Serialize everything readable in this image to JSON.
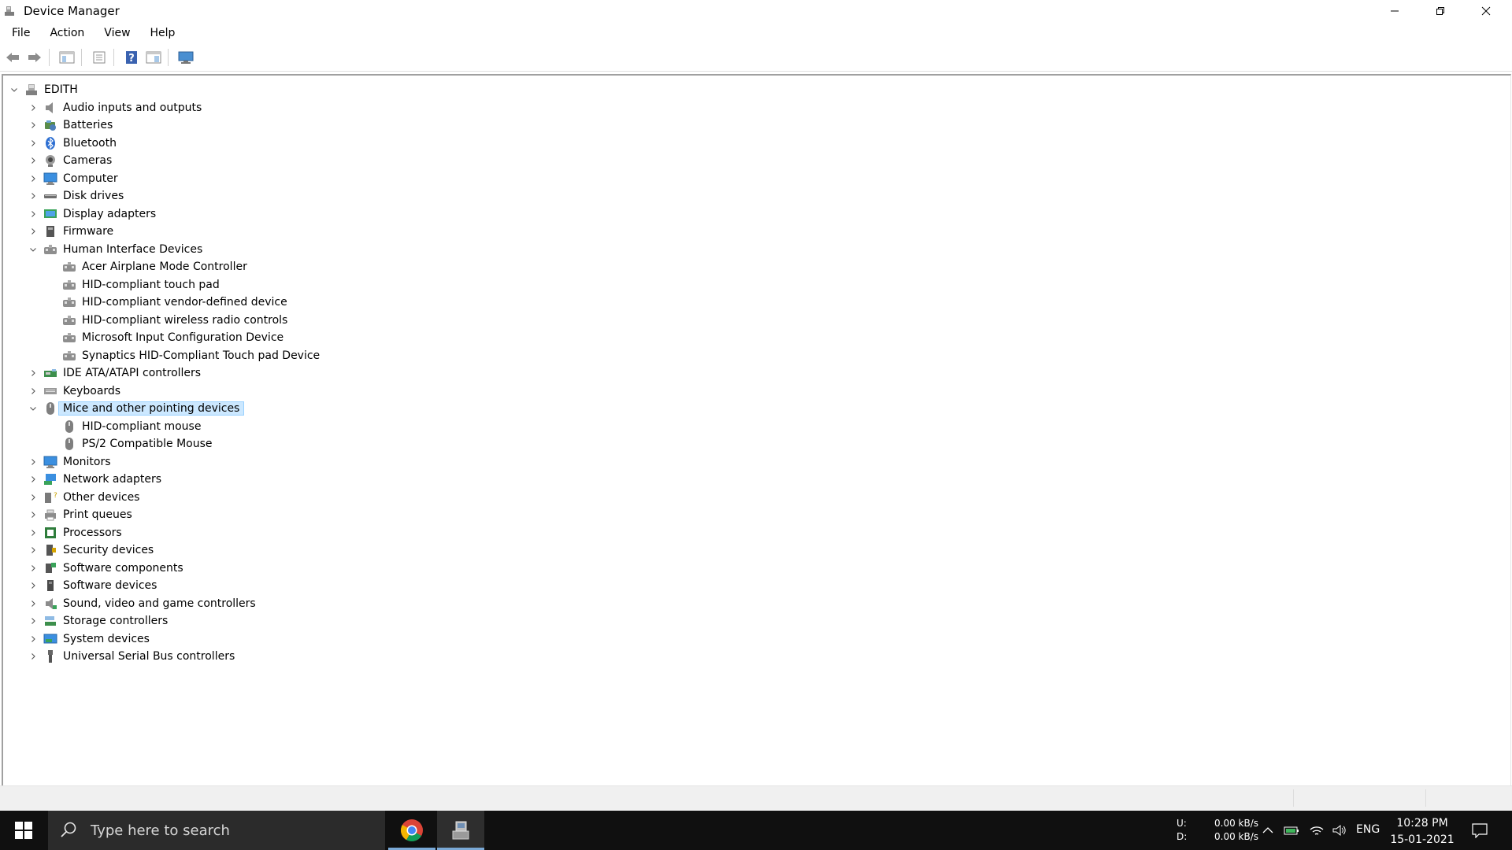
{
  "window": {
    "title": "Device Manager"
  },
  "menu": [
    "File",
    "Action",
    "View",
    "Help"
  ],
  "toolbar": {
    "buttons": [
      "back-icon",
      "forward-icon",
      "show-hide-console-tree-icon",
      "properties-icon",
      "help-icon",
      "action-pane-icon",
      "scan-hardware-icon"
    ]
  },
  "tree": {
    "root": "EDITH",
    "categories": [
      {
        "label": "Audio inputs and outputs",
        "icon": "speaker-icon",
        "expanded": false
      },
      {
        "label": "Batteries",
        "icon": "battery-icon",
        "expanded": false
      },
      {
        "label": "Bluetooth",
        "icon": "bluetooth-icon",
        "expanded": false
      },
      {
        "label": "Cameras",
        "icon": "camera-icon",
        "expanded": false
      },
      {
        "label": "Computer",
        "icon": "computer-icon",
        "expanded": false
      },
      {
        "label": "Disk drives",
        "icon": "disk-drive-icon",
        "expanded": false
      },
      {
        "label": "Display adapters",
        "icon": "display-adapter-icon",
        "expanded": false
      },
      {
        "label": "Firmware",
        "icon": "firmware-icon",
        "expanded": false
      },
      {
        "label": "Human Interface Devices",
        "icon": "hid-icon",
        "expanded": true,
        "children": [
          "Acer Airplane Mode Controller",
          "HID-compliant touch pad",
          "HID-compliant vendor-defined device",
          "HID-compliant wireless radio controls",
          "Microsoft Input Configuration Device",
          "Synaptics HID-Compliant Touch pad Device"
        ]
      },
      {
        "label": "IDE ATA/ATAPI controllers",
        "icon": "ide-controller-icon",
        "expanded": false
      },
      {
        "label": "Keyboards",
        "icon": "keyboard-icon",
        "expanded": false
      },
      {
        "label": "Mice and other pointing devices",
        "icon": "mouse-icon",
        "expanded": true,
        "selected": true,
        "children": [
          "HID-compliant mouse",
          "PS/2 Compatible Mouse"
        ]
      },
      {
        "label": "Monitors",
        "icon": "monitor-icon",
        "expanded": false
      },
      {
        "label": "Network adapters",
        "icon": "network-adapter-icon",
        "expanded": false
      },
      {
        "label": "Other devices",
        "icon": "other-devices-icon",
        "expanded": false
      },
      {
        "label": "Print queues",
        "icon": "printer-icon",
        "expanded": false
      },
      {
        "label": "Processors",
        "icon": "processor-icon",
        "expanded": false
      },
      {
        "label": "Security devices",
        "icon": "security-device-icon",
        "expanded": false
      },
      {
        "label": "Software components",
        "icon": "software-component-icon",
        "expanded": false
      },
      {
        "label": "Software devices",
        "icon": "software-device-icon",
        "expanded": false
      },
      {
        "label": "Sound, video and game controllers",
        "icon": "sound-controller-icon",
        "expanded": false
      },
      {
        "label": "Storage controllers",
        "icon": "storage-controller-icon",
        "expanded": false
      },
      {
        "label": "System devices",
        "icon": "system-devices-icon",
        "expanded": false
      },
      {
        "label": "Universal Serial Bus controllers",
        "icon": "usb-icon",
        "expanded": false
      }
    ]
  },
  "taskbar": {
    "search_placeholder": "Type here to search",
    "net_up_label": "U:",
    "net_down_label": "D:",
    "net_up": "0.00 kB/s",
    "net_down": "0.00 kB/s",
    "language": "ENG",
    "time": "10:28 PM",
    "date": "15-01-2021"
  },
  "colors": {
    "selection_bg": "#cce8ff",
    "selection_border": "#99d1ff",
    "taskbar_bg": "#101010",
    "search_bg": "#2b2b2b"
  }
}
